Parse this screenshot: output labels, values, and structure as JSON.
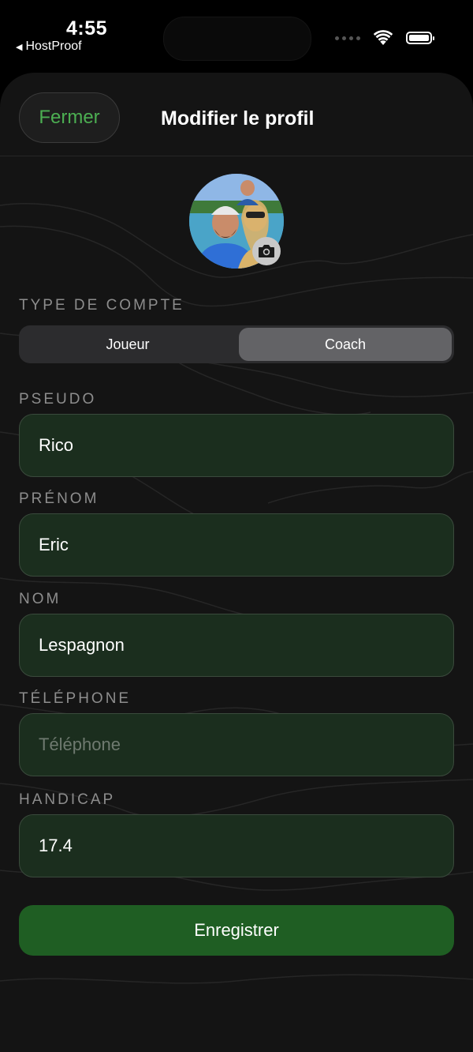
{
  "status_bar": {
    "time": "4:55",
    "back_app": "HostProof"
  },
  "header": {
    "close_label": "Fermer",
    "title": "Modifier le profil"
  },
  "colors": {
    "accent": "#4cae52",
    "field_bg": "#1b2e1e",
    "save_bg": "#1f5e23",
    "sheet_bg": "#141414"
  },
  "account_type": {
    "label": "TYPE DE COMPTE",
    "options": [
      "Joueur",
      "Coach"
    ],
    "selected": "Coach"
  },
  "fields": {
    "pseudo": {
      "label": "PSEUDO",
      "value": "Rico",
      "placeholder": ""
    },
    "prenom": {
      "label": "PRÉNOM",
      "value": "Eric",
      "placeholder": ""
    },
    "nom": {
      "label": "NOM",
      "value": "Lespagnon",
      "placeholder": ""
    },
    "telephone": {
      "label": "TÉLÉPHONE",
      "value": "",
      "placeholder": "Téléphone"
    },
    "handicap": {
      "label": "HANDICAP",
      "value": "17.4",
      "placeholder": ""
    }
  },
  "actions": {
    "save_label": "Enregistrer"
  },
  "icons": {
    "avatar": "profile-photo",
    "camera": "camera-icon",
    "wifi": "wifi-icon",
    "battery": "battery-icon",
    "back": "back-triangle-icon"
  }
}
